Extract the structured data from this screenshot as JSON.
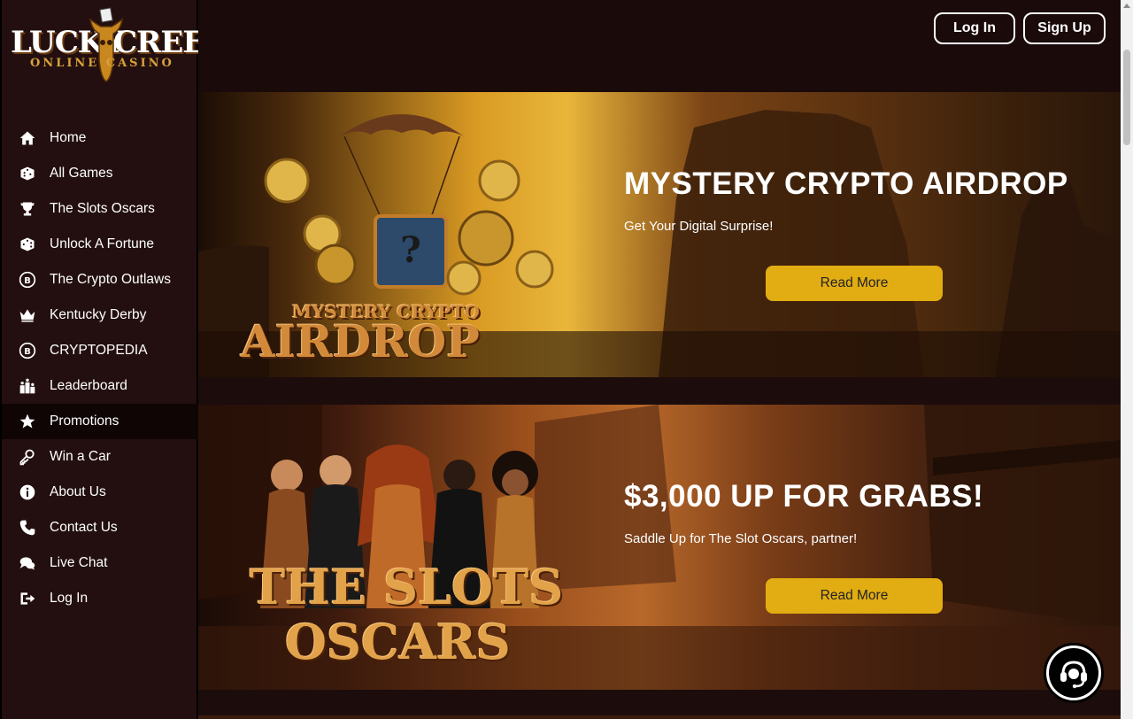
{
  "brand": {
    "logo_word_1": "LUCKY",
    "logo_word_2": "CREEK",
    "logo_sub": "ONLINE CASINO"
  },
  "sidebar": {
    "items": [
      {
        "label": "Home",
        "icon": "home-icon"
      },
      {
        "label": "All Games",
        "icon": "dice-icon"
      },
      {
        "label": "The Slots Oscars",
        "icon": "trophy-icon"
      },
      {
        "label": "Unlock A Fortune",
        "icon": "dice-icon"
      },
      {
        "label": "The Crypto Outlaws",
        "icon": "bitcoin-icon"
      },
      {
        "label": "Kentucky Derby",
        "icon": "crown-icon"
      },
      {
        "label": "CRYPTOPEDIA",
        "icon": "bitcoin-icon"
      },
      {
        "label": "Leaderboard",
        "icon": "leaderboard-icon"
      },
      {
        "label": "Promotions",
        "icon": "star-icon",
        "active": true
      },
      {
        "label": "Win a Car",
        "icon": "key-icon"
      },
      {
        "label": "About Us",
        "icon": "info-icon"
      },
      {
        "label": "Contact Us",
        "icon": "phone-icon"
      },
      {
        "label": "Live Chat",
        "icon": "chat-icon"
      },
      {
        "label": "Log In",
        "icon": "login-icon"
      }
    ]
  },
  "header": {
    "login_label": "Log In",
    "signup_label": "Sign Up"
  },
  "promotions": [
    {
      "title": "MYSTERY CRYPTO AIRDROP",
      "subtitle": "Get Your Digital Surprise!",
      "button_label": "Read More",
      "art_line_1": "MYSTERY CRYPTO",
      "art_line_2": "AIRDROP"
    },
    {
      "title": "$3,000 UP FOR GRABS!",
      "subtitle": "Saddle Up for The Slot Oscars, partner!",
      "button_label": "Read More",
      "art_line_1": "THE SLOTS",
      "art_line_2": "OSCARS"
    }
  ],
  "colors": {
    "accent_button": "#e2ad12",
    "sidebar_bg": "#230f0f",
    "header_bg": "#1a0a0a"
  },
  "chat_widget": {
    "icon": "headset-icon"
  }
}
